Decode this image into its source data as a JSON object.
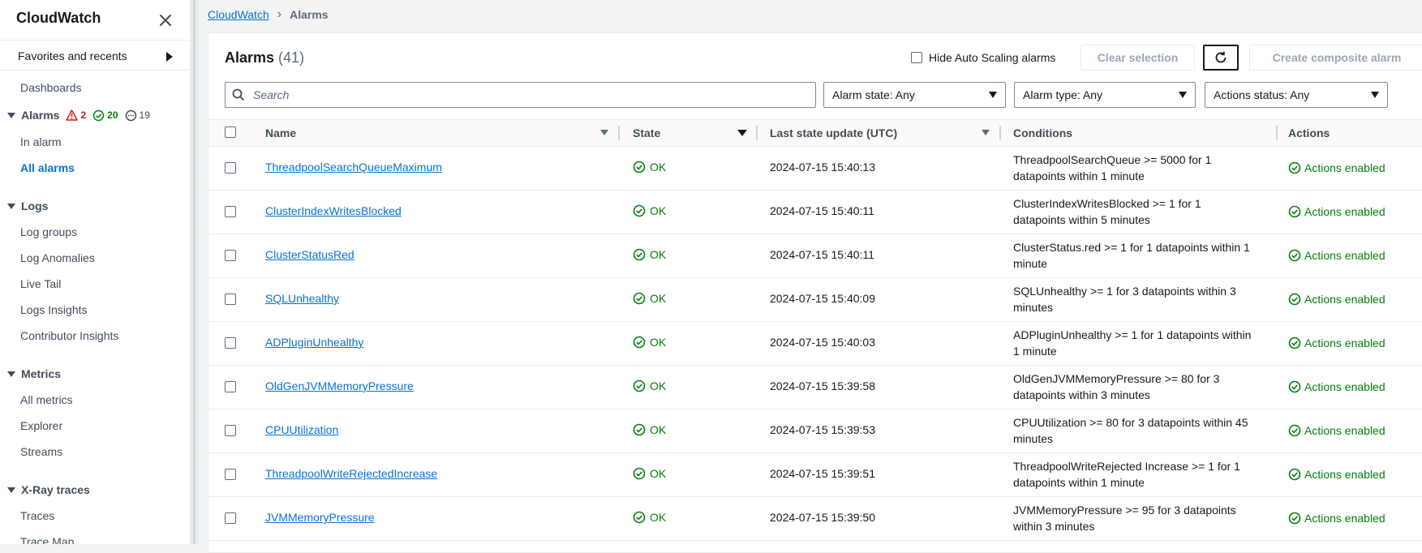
{
  "sidebar": {
    "title": "CloudWatch",
    "favorites_label": "Favorites and recents",
    "dashboards": "Dashboards",
    "alarms": {
      "label": "Alarms",
      "in_alarm_count": "2",
      "ok_count": "20",
      "insufficient_count": "19",
      "items": [
        "In alarm",
        "All alarms"
      ]
    },
    "logs": {
      "label": "Logs",
      "items": [
        "Log groups",
        "Log Anomalies",
        "Live Tail",
        "Logs Insights",
        "Contributor Insights"
      ]
    },
    "metrics": {
      "label": "Metrics",
      "items": [
        "All metrics",
        "Explorer",
        "Streams"
      ]
    },
    "xray": {
      "label": "X-Ray traces",
      "items": [
        "Traces",
        "Trace Map"
      ]
    }
  },
  "breadcrumb": {
    "root": "CloudWatch",
    "current": "Alarms"
  },
  "panel": {
    "title": "Alarms",
    "count": "(41)",
    "hide_autoscaling_label": "Hide Auto Scaling alarms",
    "clear_selection": "Clear selection",
    "create_composite": "Create composite alarm",
    "search_placeholder": "Search",
    "filters": {
      "alarm_state": "Alarm state: Any",
      "alarm_type": "Alarm type: Any",
      "actions_status": "Actions status: Any"
    }
  },
  "table": {
    "columns": {
      "name": "Name",
      "state": "State",
      "last_update": "Last state update (UTC)",
      "conditions": "Conditions",
      "actions": "Actions"
    },
    "rows": [
      {
        "name": "ThreadpoolSearchQueueMaximum",
        "state": "OK",
        "time": "2024-07-15 15:40:13",
        "conditions": "ThreadpoolSearchQueue >= 5000 for 1 datapoints within 1 minute",
        "actions": "Actions enabled"
      },
      {
        "name": "ClusterIndexWritesBlocked",
        "state": "OK",
        "time": "2024-07-15 15:40:11",
        "conditions": "ClusterIndexWritesBlocked >= 1 for 1 datapoints within 5 minutes",
        "actions": "Actions enabled"
      },
      {
        "name": "ClusterStatusRed",
        "state": "OK",
        "time": "2024-07-15 15:40:11",
        "conditions": "ClusterStatus.red >= 1 for 1 datapoints within 1 minute",
        "actions": "Actions enabled"
      },
      {
        "name": "SQLUnhealthy",
        "state": "OK",
        "time": "2024-07-15 15:40:09",
        "conditions": "SQLUnhealthy >= 1 for 3 datapoints within 3 minutes",
        "actions": "Actions enabled"
      },
      {
        "name": "ADPluginUnhealthy",
        "state": "OK",
        "time": "2024-07-15 15:40:03",
        "conditions": "ADPluginUnhealthy >= 1 for 1 datapoints within 1 minute",
        "actions": "Actions enabled"
      },
      {
        "name": "OldGenJVMMemoryPressure",
        "state": "OK",
        "time": "2024-07-15 15:39:58",
        "conditions": "OldGenJVMMemoryPressure >= 80 for 3 datapoints within 3 minutes",
        "actions": "Actions enabled"
      },
      {
        "name": "CPUUtilization",
        "state": "OK",
        "time": "2024-07-15 15:39:53",
        "conditions": "CPUUtilization >= 80 for 3 datapoints within 45 minutes",
        "actions": "Actions enabled"
      },
      {
        "name": "ThreadpoolWriteRejectedIncrease",
        "state": "OK",
        "time": "2024-07-15 15:39:51",
        "conditions": "ThreadpoolWriteRejected Increase >= 1 for 1 datapoints within 1 minute",
        "actions": "Actions enabled"
      },
      {
        "name": "JVMMemoryPressure",
        "state": "OK",
        "time": "2024-07-15 15:39:50",
        "conditions": "JVMMemoryPressure >= 95 for 3 datapoints within 3 minutes",
        "actions": "Actions enabled"
      }
    ]
  },
  "colors": {
    "link": "#0972d3",
    "ok_green": "#037f0c",
    "alarm_red": "#d91515",
    "text": "#16191f"
  }
}
